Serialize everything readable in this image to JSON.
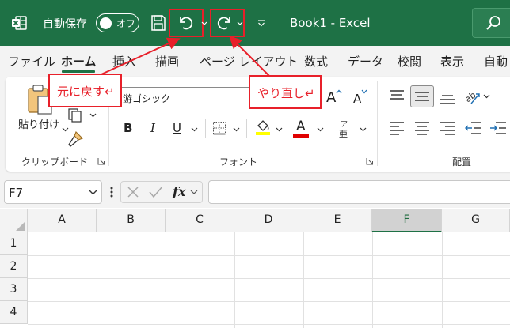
{
  "titlebar": {
    "autosave_label": "自動保存",
    "toggle_state": "オフ",
    "title": "Book1  -  Excel"
  },
  "tabs": [
    {
      "label": "ファイル"
    },
    {
      "label": "ホーム"
    },
    {
      "label": "挿入"
    },
    {
      "label": "描画"
    },
    {
      "label": "ページ レイアウト"
    },
    {
      "label": "数式"
    },
    {
      "label": "データ"
    },
    {
      "label": "校閲"
    },
    {
      "label": "表示"
    },
    {
      "label": "自動"
    }
  ],
  "ribbon": {
    "clipboard": {
      "paste_label": "貼り付け",
      "group_label": "クリップボード"
    },
    "font": {
      "font_name": "游ゴシック",
      "group_label": "フォント",
      "bold": "B",
      "italic": "I",
      "underline": "U",
      "font_color_glyph": "A",
      "phonetic_top": "ア",
      "phonetic_bottom": "亜",
      "grow": "A",
      "shrink": "A"
    },
    "alignment": {
      "group_label": "配置"
    }
  },
  "callouts": {
    "undo": "元に戻す↵",
    "redo": "やり直し↵"
  },
  "formula_bar": {
    "name_box": "F7",
    "fx": "fx"
  },
  "grid": {
    "columns": [
      "A",
      "B",
      "C",
      "D",
      "E",
      "F",
      "G"
    ],
    "rows": [
      "1",
      "2",
      "3",
      "4"
    ],
    "selected_column": "F"
  },
  "colors": {
    "brand": "#1e7145",
    "annotation": "#e8202a",
    "highlight_yellow": "#ffff00",
    "font_red": "#e00000"
  }
}
